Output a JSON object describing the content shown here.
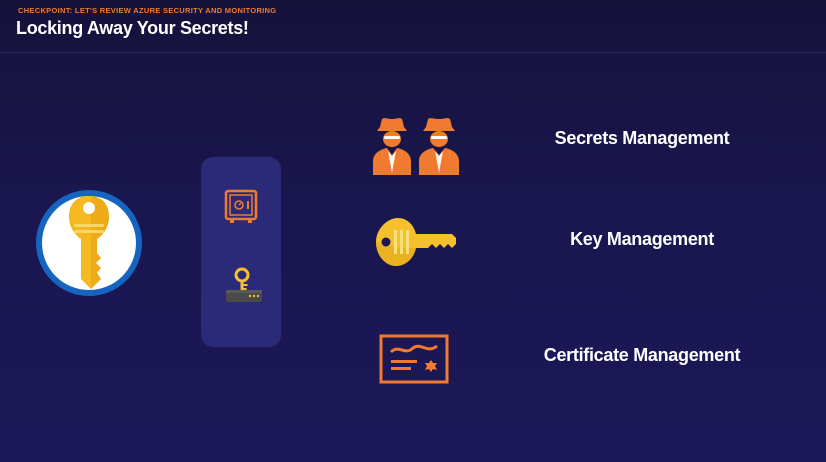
{
  "header": {
    "eyebrow": "CHECKPOINT: LET'S REVIEW AZURE SECURITY AND MONITORING",
    "title": "Locking Away Your Secrets!"
  },
  "logo": {
    "icon": "key-vault-icon"
  },
  "panel": {
    "icons": [
      "safe-icon",
      "key-on-device-icon"
    ]
  },
  "rows": [
    {
      "label": "Secrets Management",
      "icon": "spies-icon"
    },
    {
      "label": "Key Management",
      "icon": "key-icon"
    },
    {
      "label": "Certificate Management",
      "icon": "certificate-icon"
    }
  ],
  "colors": {
    "accent": "#f07a30",
    "gold": "#f5c02e",
    "panel": "#2b2a78",
    "logo_ring": "#1565c0"
  }
}
